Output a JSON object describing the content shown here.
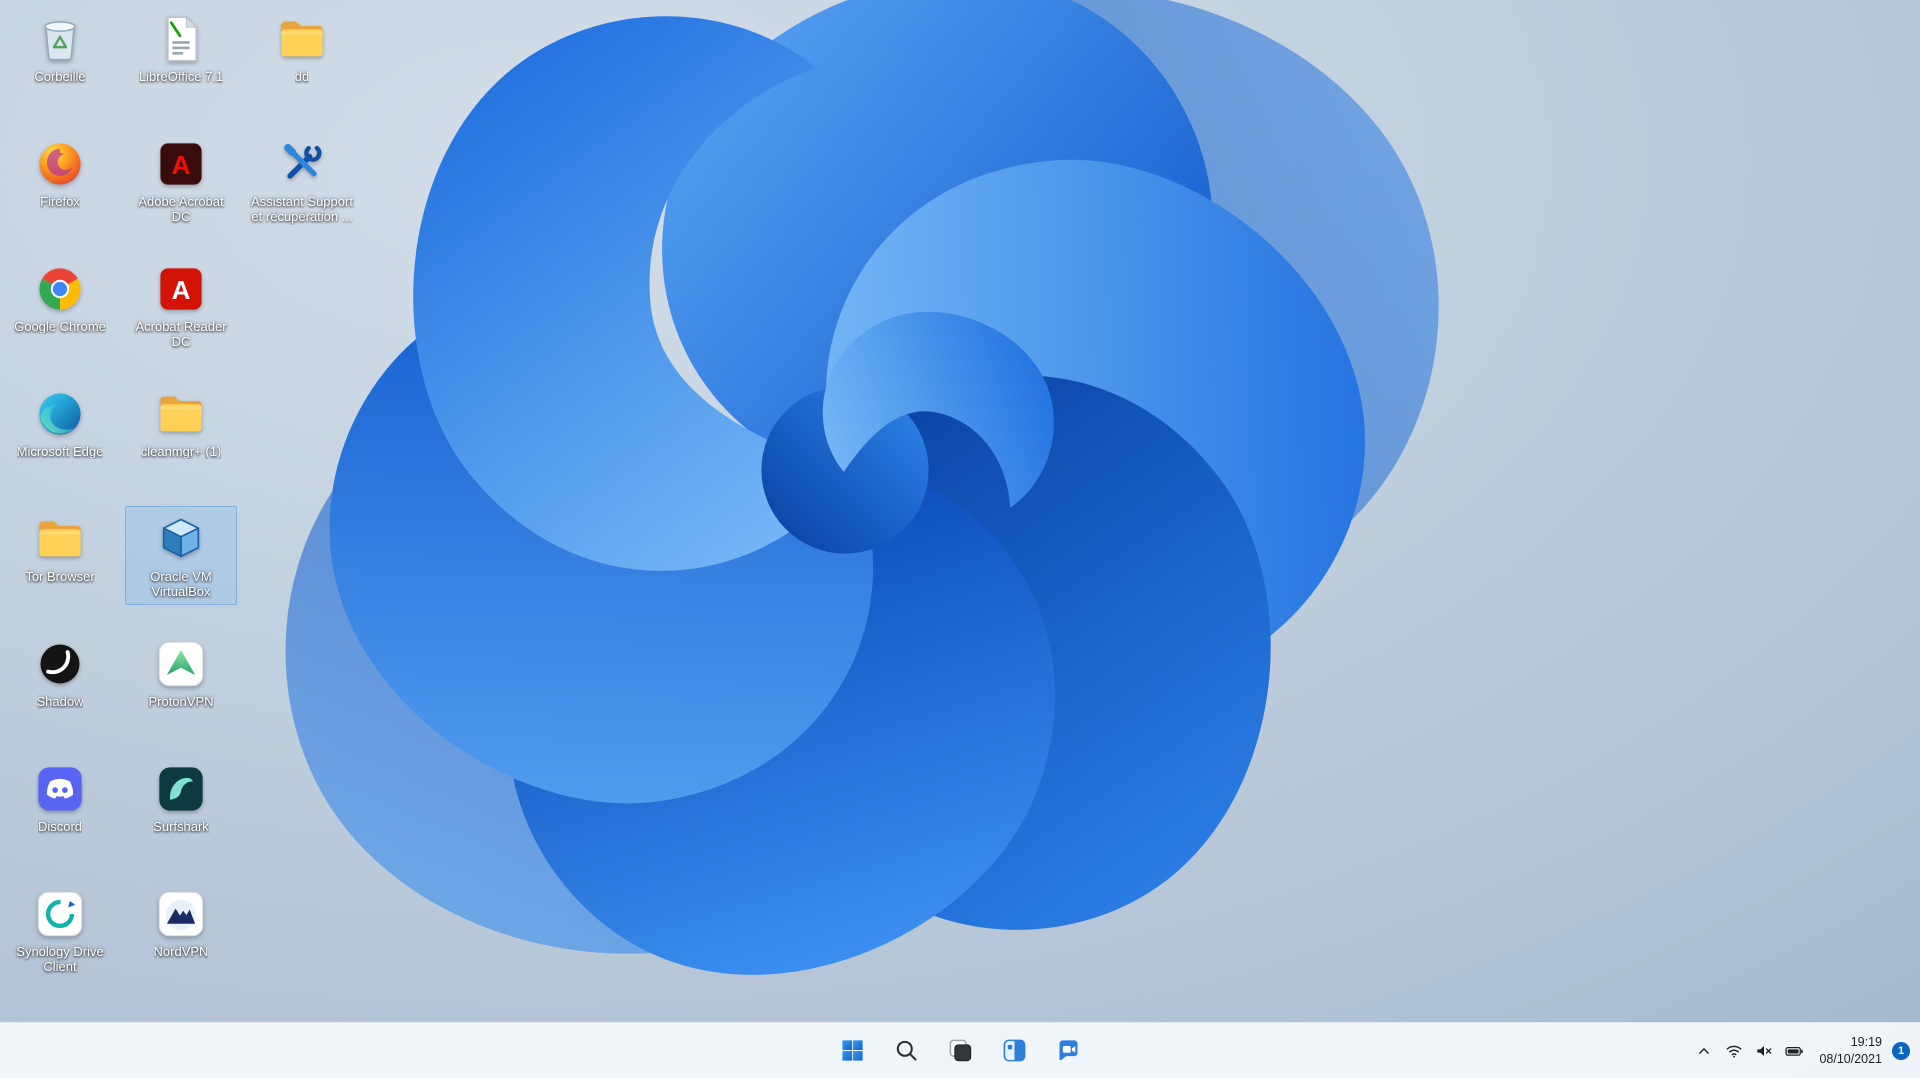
{
  "colors": {
    "accent": "#0e77d3",
    "selection": "#9ec7ec",
    "badge": "#0b63c4",
    "taskbar_background": "#f3f7fb"
  },
  "desktop": {
    "icons": [
      {
        "id": "corbeille",
        "label": "Corbeille",
        "icon": "recycle-bin-icon",
        "col": 0,
        "row": 0,
        "selected": false
      },
      {
        "id": "libreoffice",
        "label": "LibreOffice 7.1",
        "icon": "libreoffice-icon",
        "col": 1,
        "row": 0,
        "selected": false
      },
      {
        "id": "dd",
        "label": "dd",
        "icon": "folder-icon",
        "col": 2,
        "row": 0,
        "selected": false
      },
      {
        "id": "firefox",
        "label": "Firefox",
        "icon": "firefox-icon",
        "col": 0,
        "row": 1,
        "selected": false
      },
      {
        "id": "adobe-acrobat-dc",
        "label": "Adobe Acrobat DC",
        "icon": "acrobat-dc-icon",
        "col": 1,
        "row": 1,
        "selected": false
      },
      {
        "id": "assistant-support",
        "label": "Assistant Support et récupération ...",
        "icon": "support-tools-icon",
        "col": 2,
        "row": 1,
        "selected": false
      },
      {
        "id": "google-chrome",
        "label": "Google Chrome",
        "icon": "chrome-icon",
        "col": 0,
        "row": 2,
        "selected": false
      },
      {
        "id": "acrobat-reader-dc",
        "label": "Acrobat Reader DC",
        "icon": "reader-dc-icon",
        "col": 1,
        "row": 2,
        "selected": false
      },
      {
        "id": "microsoft-edge",
        "label": "Microsoft Edge",
        "icon": "edge-icon",
        "col": 0,
        "row": 3,
        "selected": false
      },
      {
        "id": "cleanmgr",
        "label": "cleanmgr+ (1)",
        "icon": "folder-icon",
        "col": 1,
        "row": 3,
        "selected": false
      },
      {
        "id": "tor-browser",
        "label": "Tor Browser",
        "icon": "folder-icon",
        "col": 0,
        "row": 4,
        "selected": false
      },
      {
        "id": "virtualbox",
        "label": "Oracle VM VirtualBox",
        "icon": "virtualbox-icon",
        "col": 1,
        "row": 4,
        "selected": true
      },
      {
        "id": "shadow",
        "label": "Shadow",
        "icon": "shadow-icon",
        "col": 0,
        "row": 5,
        "selected": false
      },
      {
        "id": "protonvpn",
        "label": "ProtonVPN",
        "icon": "protonvpn-icon",
        "col": 1,
        "row": 5,
        "selected": false
      },
      {
        "id": "discord",
        "label": "Discord",
        "icon": "discord-icon",
        "col": 0,
        "row": 6,
        "selected": false
      },
      {
        "id": "surfshark",
        "label": "Surfshark",
        "icon": "surfshark-icon",
        "col": 1,
        "row": 6,
        "selected": false
      },
      {
        "id": "synology",
        "label": "Synology Drive Client",
        "icon": "synology-icon",
        "col": 0,
        "row": 7,
        "selected": false
      },
      {
        "id": "nordvpn",
        "label": "NordVPN",
        "icon": "nordvpn-icon",
        "col": 1,
        "row": 7,
        "selected": false
      }
    ]
  },
  "taskbar": {
    "buttons": [
      {
        "id": "start",
        "icon": "start-icon"
      },
      {
        "id": "search",
        "icon": "search-icon"
      },
      {
        "id": "task-view",
        "icon": "task-view-icon"
      },
      {
        "id": "widgets",
        "icon": "widgets-icon"
      },
      {
        "id": "chat",
        "icon": "chat-icon"
      }
    ],
    "tray": {
      "icons": [
        {
          "id": "hidden-icons",
          "icon": "chevron-up-icon"
        },
        {
          "id": "network",
          "icon": "wifi-icon"
        },
        {
          "id": "volume",
          "icon": "volume-muted-icon"
        },
        {
          "id": "battery",
          "icon": "battery-icon"
        }
      ],
      "time": "19:19",
      "date": "08/10/2021",
      "notification_badge": "1"
    }
  }
}
